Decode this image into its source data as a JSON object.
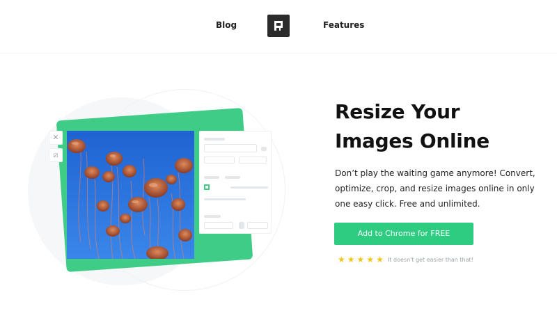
{
  "nav": {
    "blog_label": "Blog",
    "features_label": "Features",
    "logo_icon": "r-logo-icon"
  },
  "hero": {
    "title": "Resize Your Images Online",
    "description": "Don’t play the waiting game anymore! Convert, optimize, crop, and resize images online in only one easy click. Free and unlimited.",
    "cta_label": "Add to Chrome for FREE",
    "rating_stars": 5,
    "rating_text": "It doesn't get easier than that!"
  },
  "illustration": {
    "icons": [
      "close-icon",
      "crop-icon",
      "jellyfish-photo"
    ]
  },
  "colors": {
    "accent": "#2ecc80",
    "card": "#3ecc86",
    "star": "#f3c51a",
    "photo_bg": "#2a6fd6"
  }
}
